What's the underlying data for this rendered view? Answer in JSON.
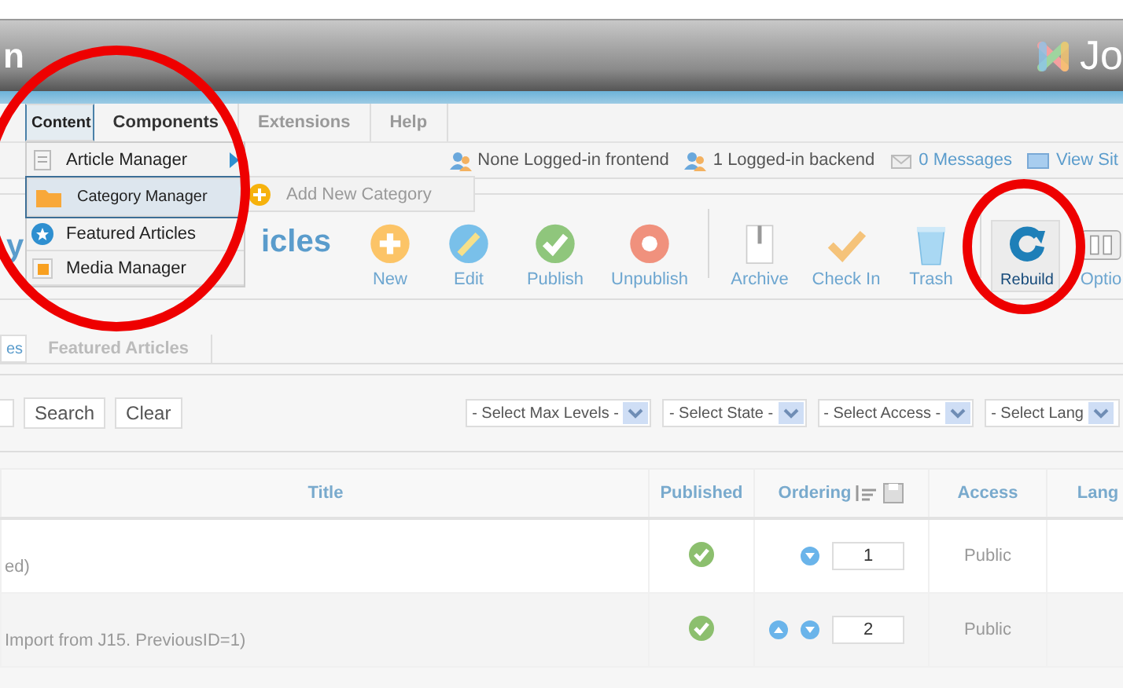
{
  "header": {
    "title_fragment": "n",
    "logo_text": "Jo"
  },
  "menu": {
    "tabs": [
      {
        "label": "Content",
        "selected": true,
        "disabled": false
      },
      {
        "label": "Components",
        "selected": false,
        "disabled": false
      },
      {
        "label": "Extensions",
        "selected": false,
        "disabled": true
      },
      {
        "label": "Help",
        "selected": false,
        "disabled": true
      }
    ],
    "dropdown": [
      {
        "label": "Article Manager",
        "selected": false,
        "has_submenu": true
      },
      {
        "label": "Category Manager",
        "selected": true,
        "has_submenu": false
      },
      {
        "label": "Featured Articles",
        "selected": false,
        "has_submenu": false
      },
      {
        "label": "Media Manager",
        "selected": false,
        "has_submenu": false
      }
    ],
    "submenu": [
      {
        "label": "Add New Category"
      }
    ]
  },
  "status": [
    {
      "label": "None Logged-in frontend",
      "link": false
    },
    {
      "label": "1 Logged-in backend",
      "link": false
    },
    {
      "label": "0 Messages",
      "link": true
    },
    {
      "label": "View Sit",
      "link": true
    }
  ],
  "page_title": {
    "start": "y",
    "end": "icles"
  },
  "toolbar": [
    {
      "label": "New",
      "selected": false
    },
    {
      "label": "Edit",
      "selected": false
    },
    {
      "label": "Publish",
      "selected": false
    },
    {
      "label": "Unpublish",
      "selected": false
    },
    {
      "label": "Archive",
      "selected": false
    },
    {
      "label": "Check In",
      "selected": false
    },
    {
      "label": "Trash",
      "selected": false
    },
    {
      "label": "Rebuild",
      "selected": true
    },
    {
      "label": "Optio",
      "selected": false
    }
  ],
  "subtabs": [
    {
      "label": "es",
      "selected": true
    },
    {
      "label": "Featured Articles",
      "selected": false
    }
  ],
  "filter": {
    "buttons": [
      "Search",
      "Clear"
    ],
    "selects": [
      "- Select Max Levels -",
      "- Select State -",
      "- Select Access -",
      "- Select Lang"
    ]
  },
  "table": {
    "columns": [
      "Title",
      "Published",
      "Ordering",
      "Access",
      "Lang"
    ],
    "rows": [
      {
        "title_note": "ed)",
        "published": true,
        "move_up": false,
        "move_down": true,
        "order": "1",
        "access": "Public"
      },
      {
        "title_note": "Import from J15. PreviousID=1)",
        "published": true,
        "move_up": true,
        "move_down": true,
        "order": "2",
        "access": "Public"
      }
    ]
  },
  "annotations": [
    {
      "kind": "ellipse"
    },
    {
      "kind": "ellipse"
    }
  ]
}
